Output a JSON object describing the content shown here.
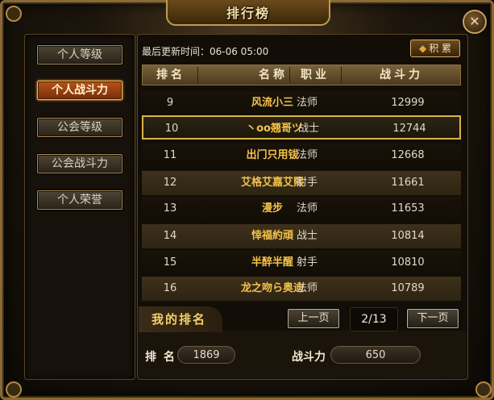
{
  "window": {
    "title": "排行榜",
    "close_label": "✕"
  },
  "sidebar": {
    "tabs": [
      {
        "label": "个人等级",
        "active": false
      },
      {
        "label": "个人战斗力",
        "active": true
      },
      {
        "label": "公会等级",
        "active": false
      },
      {
        "label": "公会战斗力",
        "active": false
      },
      {
        "label": "个人荣誉",
        "active": false
      }
    ]
  },
  "main": {
    "update_text": "最后更新时间：06-06 05:00",
    "rank_button_label": "积 累",
    "headers": [
      "排名",
      "名称",
      "职业",
      "战斗力"
    ],
    "rows": [
      {
        "rank": "9",
        "name": "风流小三",
        "job": "法师",
        "power": "12999"
      },
      {
        "rank": "10",
        "name": "丶oo翘哥ツ",
        "job": "战士",
        "power": "12744"
      },
      {
        "rank": "11",
        "name": "出门只用钹",
        "job": "法师",
        "power": "12668"
      },
      {
        "rank": "12",
        "name": "艾格艾嘉艾熙",
        "job": "射手",
        "power": "11661"
      },
      {
        "rank": "13",
        "name": "漫步",
        "job": "法师",
        "power": "11653"
      },
      {
        "rank": "14",
        "name": "悻福約頑",
        "job": "战士",
        "power": "10814"
      },
      {
        "rank": "15",
        "name": "半醉半醒",
        "job": "射手",
        "power": "10810"
      },
      {
        "rank": "16",
        "name": "龙之吻ら奥迪",
        "job": "法师",
        "power": "10789"
      }
    ],
    "selected_row": 1
  },
  "my_rank": {
    "title": "我的排名",
    "rank_label": "排 名",
    "rank_value": "1869",
    "power_label": "战斗力",
    "power_value": "650"
  },
  "pagination": {
    "prev_label": "上一页",
    "next_label": "下一页",
    "page_info": "2/13"
  }
}
